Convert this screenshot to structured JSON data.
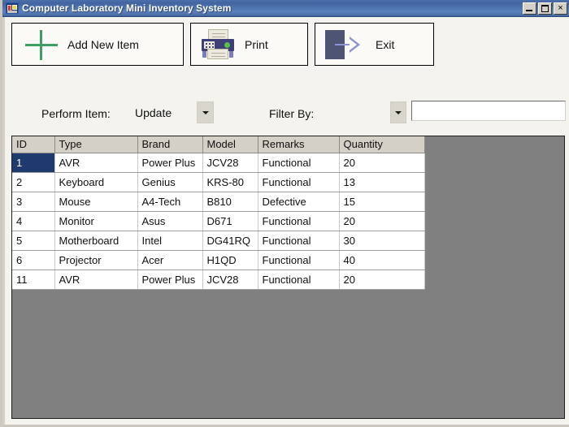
{
  "window": {
    "title": "Computer Laboratory Mini Inventory System",
    "icon": "app-icon",
    "minimize_label": "_",
    "maximize_label": "",
    "close_label": "×"
  },
  "toolbar": {
    "buttons": [
      {
        "label": "Add New Item",
        "icon": "plus-icon"
      },
      {
        "label": "Print",
        "icon": "printer-icon"
      },
      {
        "label": "Exit",
        "icon": "exit-arrow-icon"
      }
    ]
  },
  "filter_bar": {
    "perform_label": "Perform Item:",
    "perform_value": "Update",
    "perform_options": [
      "Update"
    ],
    "filter_label": "Filter By:",
    "filter_value": "",
    "filter_options": [],
    "search_value": "",
    "search_placeholder": ""
  },
  "grid": {
    "columns": [
      "ID",
      "Type",
      "Brand",
      "Model",
      "Remarks",
      "Quantity"
    ],
    "selected_row": 0,
    "selected_cell": "ID",
    "rows": [
      {
        "id": "1",
        "type": "AVR",
        "brand": "Power Plus",
        "model": "JCV28",
        "remarks": "Functional",
        "quantity": "20"
      },
      {
        "id": "2",
        "type": "Keyboard",
        "brand": "Genius",
        "model": "KRS-80",
        "remarks": "Functional",
        "quantity": "13"
      },
      {
        "id": "3",
        "type": "Mouse",
        "brand": "A4-Tech",
        "model": "B810",
        "remarks": "Defective",
        "quantity": "15"
      },
      {
        "id": "4",
        "type": "Monitor",
        "brand": "Asus",
        "model": "D671",
        "remarks": "Functional",
        "quantity": "20"
      },
      {
        "id": "5",
        "type": "Motherboard",
        "brand": "Intel",
        "model": "DG41RQ",
        "remarks": "Functional",
        "quantity": "30"
      },
      {
        "id": "6",
        "type": "Projector",
        "brand": "Acer",
        "model": "H1QD",
        "remarks": "Functional",
        "quantity": "40"
      },
      {
        "id": "11",
        "type": "AVR",
        "brand": "Power Plus",
        "model": "JCV28",
        "remarks": "Functional",
        "quantity": "20"
      }
    ]
  },
  "colors": {
    "titlebar": "#4a6ea9",
    "selection": "#1f3a6e",
    "grid_background": "#808080",
    "header": "#d4d0c8",
    "plus_icon": "#3f9e62",
    "printer_body": "#3d3f76",
    "printer_led": "#59c04a",
    "exit_door": "#4e5572",
    "exit_arrow": "#8e93d6"
  }
}
